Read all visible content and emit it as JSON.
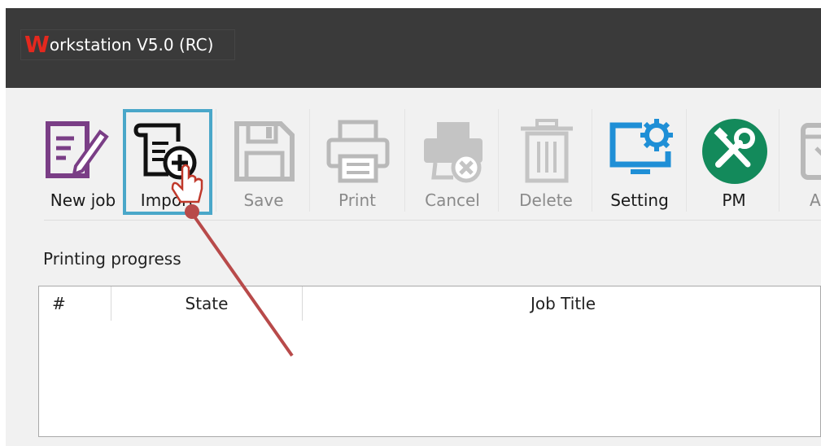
{
  "window": {
    "title_first_letter": "W",
    "title_rest": "orkstation V5.0 (RC)"
  },
  "toolbar": {
    "buttons": [
      {
        "label": "New job",
        "icon": "new-job-icon",
        "enabled": true
      },
      {
        "label": "Import",
        "icon": "import-icon",
        "enabled": true,
        "selected": true
      },
      {
        "label": "Save",
        "icon": "save-icon",
        "enabled": false
      },
      {
        "label": "Print",
        "icon": "print-icon",
        "enabled": false
      },
      {
        "label": "Cancel",
        "icon": "cancel-print-icon",
        "enabled": false
      },
      {
        "label": "Delete",
        "icon": "trash-icon",
        "enabled": false
      },
      {
        "label": "Setting",
        "icon": "monitor-gear-icon",
        "enabled": true
      },
      {
        "label": "PM",
        "icon": "tools-icon",
        "enabled": true
      },
      {
        "label": "A",
        "icon": "window-icon",
        "enabled": false
      }
    ]
  },
  "progress": {
    "section_label": "Printing progress",
    "columns": [
      "#",
      "State",
      "Job Title"
    ],
    "rows": []
  },
  "colors": {
    "titlebar": "#3a3a3a",
    "title_accent": "#e5281e",
    "selection_border": "#4aa7c9",
    "setting_blue": "#1f8fd6",
    "pm_green": "#138a5b",
    "new_job_purple": "#7a3e86",
    "annotation_arrow": "#b84a4a"
  }
}
